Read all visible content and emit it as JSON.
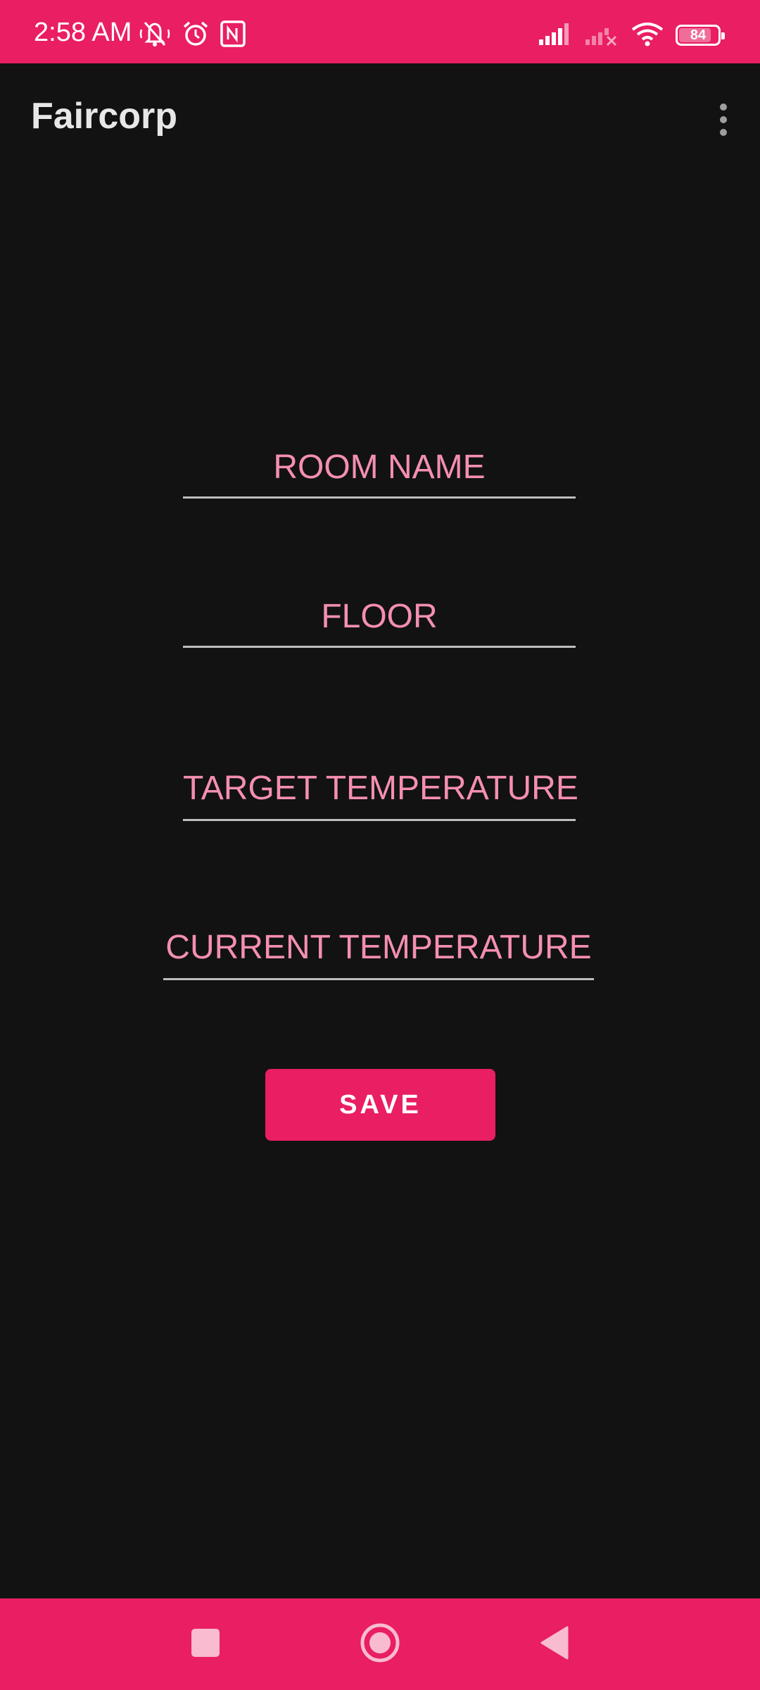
{
  "status_bar": {
    "time": "2:58 AM",
    "battery_level": "84",
    "battery_fraction": 0.84,
    "icons": [
      "notifications-muted-icon",
      "alarm-icon",
      "nfc-icon",
      "signal-icon",
      "signal-no-service-icon",
      "wifi-icon",
      "battery-icon"
    ]
  },
  "app_bar": {
    "title": "Faircorp",
    "overflow_icon": "more-vert-icon"
  },
  "form": {
    "room_name_hint": "ROOM NAME",
    "floor_hint": "FLOOR",
    "target_temperature_hint": "TARGET TEMPERATURE",
    "current_temperature_hint": "CURRENT TEMPERATURE",
    "save_label": "SAVE"
  },
  "navigation_bar": {
    "icons": [
      "recents-square-icon",
      "home-circle-icon",
      "back-triangle-icon"
    ]
  },
  "colors": {
    "accent": "#E91E63",
    "hint_text": "#F48FB1",
    "background": "#121212",
    "title_text": "#e7e7e7"
  }
}
